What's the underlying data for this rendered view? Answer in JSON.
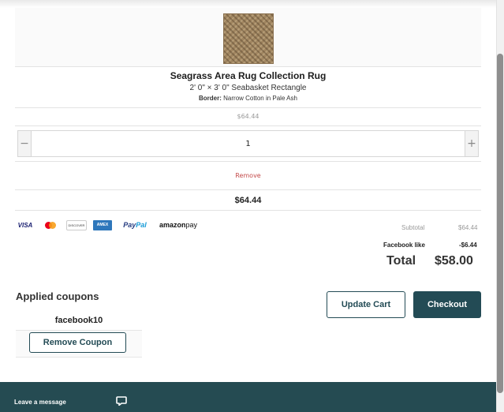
{
  "product": {
    "title": "Seagrass Area Rug Collection Rug",
    "size": "2' 0\" × 3' 0\" Seabasket Rectangle",
    "border_label": "Border:",
    "border_value": "Narrow Cotton in Pale Ash",
    "unit_price": "$64.44",
    "quantity": "1",
    "remove_label": "Remove",
    "line_total": "$64.44"
  },
  "icons": {
    "qty_minus": "−",
    "qty_plus": "+"
  },
  "payment_methods": {
    "visa": "VISA",
    "mastercard": "mastercard-icon",
    "discover": "DISCOVER",
    "amex": "AMEX",
    "paypal_a": "Pay",
    "paypal_b": "Pal",
    "amazon_a": "amazon",
    "amazon_b": " pay"
  },
  "summary": {
    "subtotal_label": "Subtotal",
    "subtotal_value": "$64.44",
    "discount_label": "Facebook like",
    "discount_value": "-$6.44",
    "total_label": "Total",
    "total_value": "$58.00"
  },
  "coupons": {
    "title": "Applied coupons",
    "code": "facebook10",
    "remove_label": "Remove Coupon"
  },
  "actions": {
    "update_cart": "Update Cart",
    "checkout": "Checkout"
  },
  "footer": {
    "leave_message": "Leave a message"
  },
  "colors": {
    "primary": "#234b55",
    "remove_text": "#c44b4b"
  }
}
